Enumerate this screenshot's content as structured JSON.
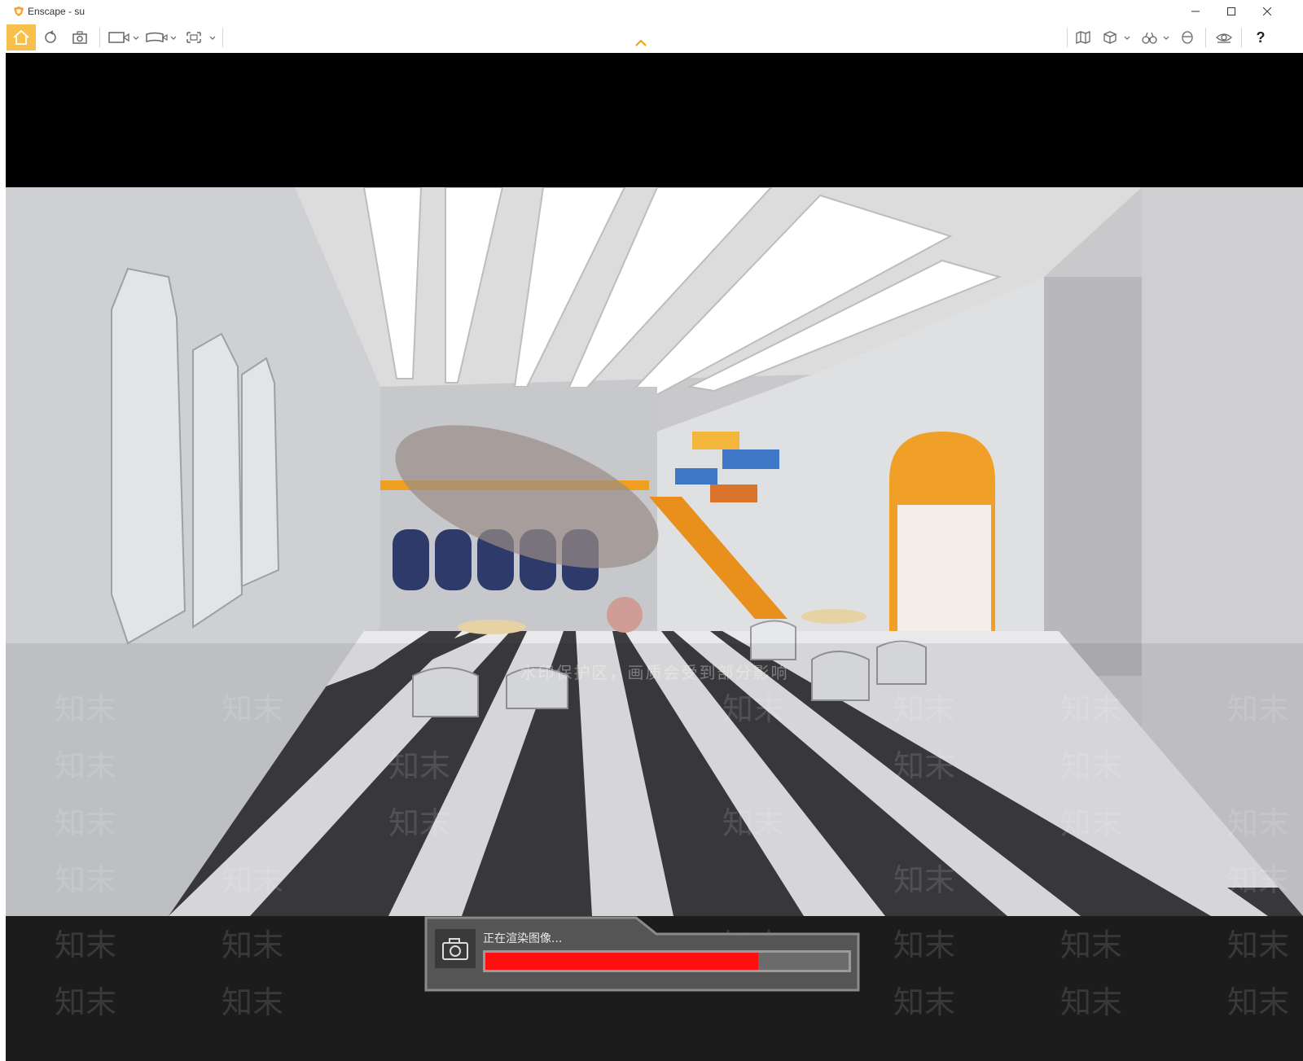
{
  "window": {
    "title": "Enscape - su"
  },
  "toolbar": {
    "left_icons": [
      "home-icon",
      "refresh-icon",
      "screenshot-icon",
      "render-video-icon",
      "render-panorama-icon",
      "batch-render-icon"
    ],
    "right_icons": [
      "map-icon",
      "view-cube-icon",
      "binoculars-icon",
      "avatar-icon",
      "visibility-icon"
    ],
    "help_label": "?"
  },
  "render": {
    "watermark_caption": "水印保护区，画质会受到部分影响",
    "watermark_text": "知末"
  },
  "progress": {
    "label": "正在渲染图像...",
    "value": 0.75
  },
  "colors": {
    "progress_fill": "#ff1010",
    "home_active": "#f6c04a",
    "caret": "#f0a000"
  }
}
